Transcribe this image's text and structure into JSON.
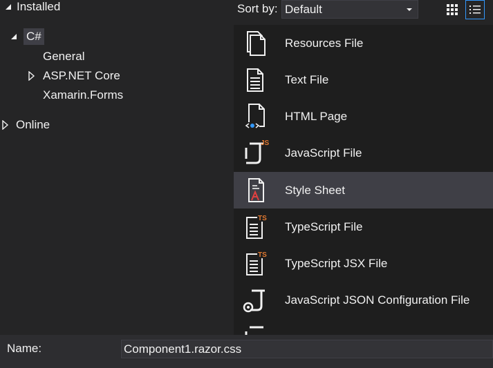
{
  "tree": {
    "installed": "Installed",
    "csharp": "C#",
    "children": [
      "General",
      "ASP.NET Core",
      "Xamarin.Forms"
    ],
    "online": "Online"
  },
  "sort": {
    "label": "Sort by:",
    "value": "Default"
  },
  "templates": [
    {
      "label": "Resources File",
      "icon": "resources-file-icon"
    },
    {
      "label": "Text File",
      "icon": "text-file-icon"
    },
    {
      "label": "HTML Page",
      "icon": "html-page-icon"
    },
    {
      "label": "JavaScript File",
      "icon": "javascript-file-icon"
    },
    {
      "label": "Style Sheet",
      "icon": "style-sheet-icon"
    },
    {
      "label": "TypeScript File",
      "icon": "typescript-file-icon"
    },
    {
      "label": "TypeScript JSX File",
      "icon": "typescript-jsx-file-icon"
    },
    {
      "label": "JavaScript JSON Configuration File",
      "icon": "javascript-json-config-icon"
    }
  ],
  "selected_template": "Style Sheet",
  "name_field": {
    "label": "Name:",
    "value": "Component1.razor.css"
  },
  "colors": {
    "accent": "#3399ff",
    "ts_orange": "#e07830",
    "selection": "#3f3f46"
  }
}
